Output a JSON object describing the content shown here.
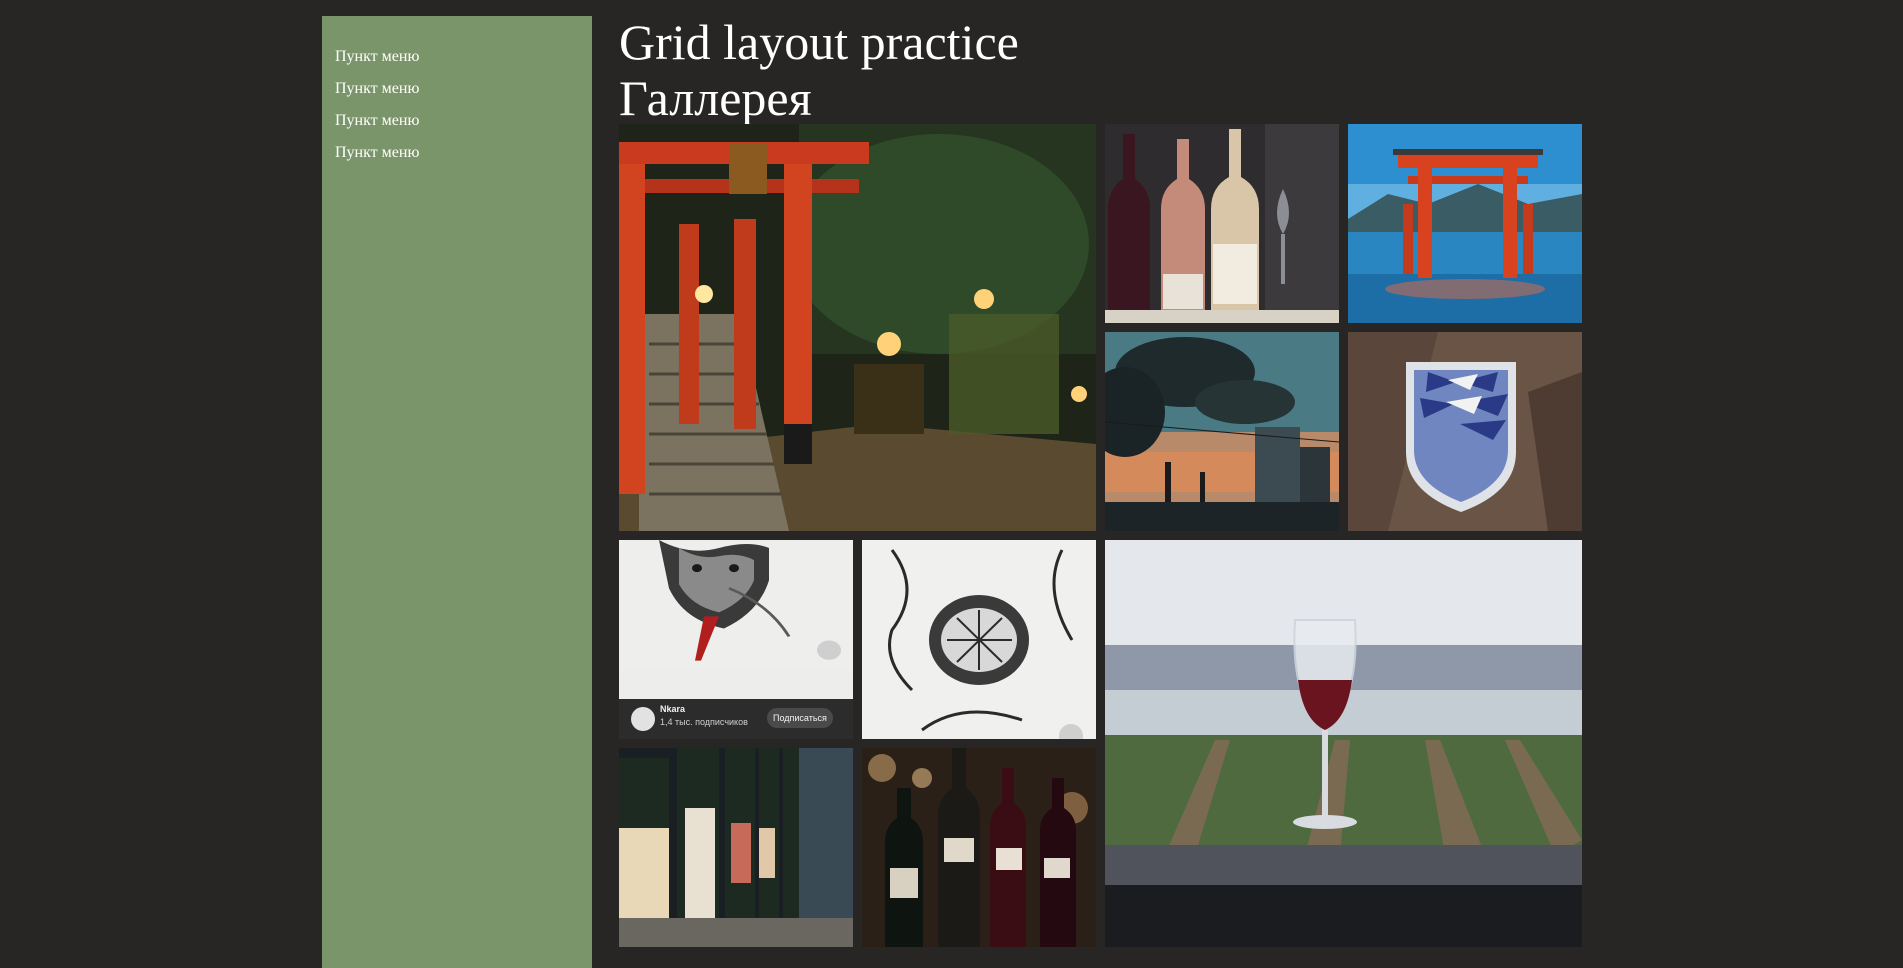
{
  "sidebar": {
    "items": [
      {
        "label": "Пункт меню"
      },
      {
        "label": "Пункт меню"
      },
      {
        "label": "Пункт меню"
      },
      {
        "label": "Пункт меню"
      }
    ]
  },
  "header": {
    "title": "Grid layout practice",
    "subtitle": "Галлерея"
  },
  "gallery": {
    "photos": [
      {
        "name": "torii-shrine-night-photo"
      },
      {
        "name": "wine-bottles-dark-photo"
      },
      {
        "name": "floating-torii-gate-photo"
      },
      {
        "name": "factory-smoke-sunset-photo"
      },
      {
        "name": "wings-of-freedom-emblem-photo"
      },
      {
        "name": "oni-mask-sketch-photo"
      },
      {
        "name": "chrysanthemum-sketch-photo"
      },
      {
        "name": "wine-glass-vineyard-photo"
      },
      {
        "name": "wine-shelf-photo"
      },
      {
        "name": "wine-bottles-bokeh-photo"
      }
    ],
    "pin_card": {
      "author": "Nkara",
      "followers": "1,4 тыс. подписчиков",
      "subscribe_label": "Подписаться"
    }
  },
  "colors": {
    "background": "#272624",
    "sidebar": "#7a956a",
    "text": "#ffffff"
  }
}
